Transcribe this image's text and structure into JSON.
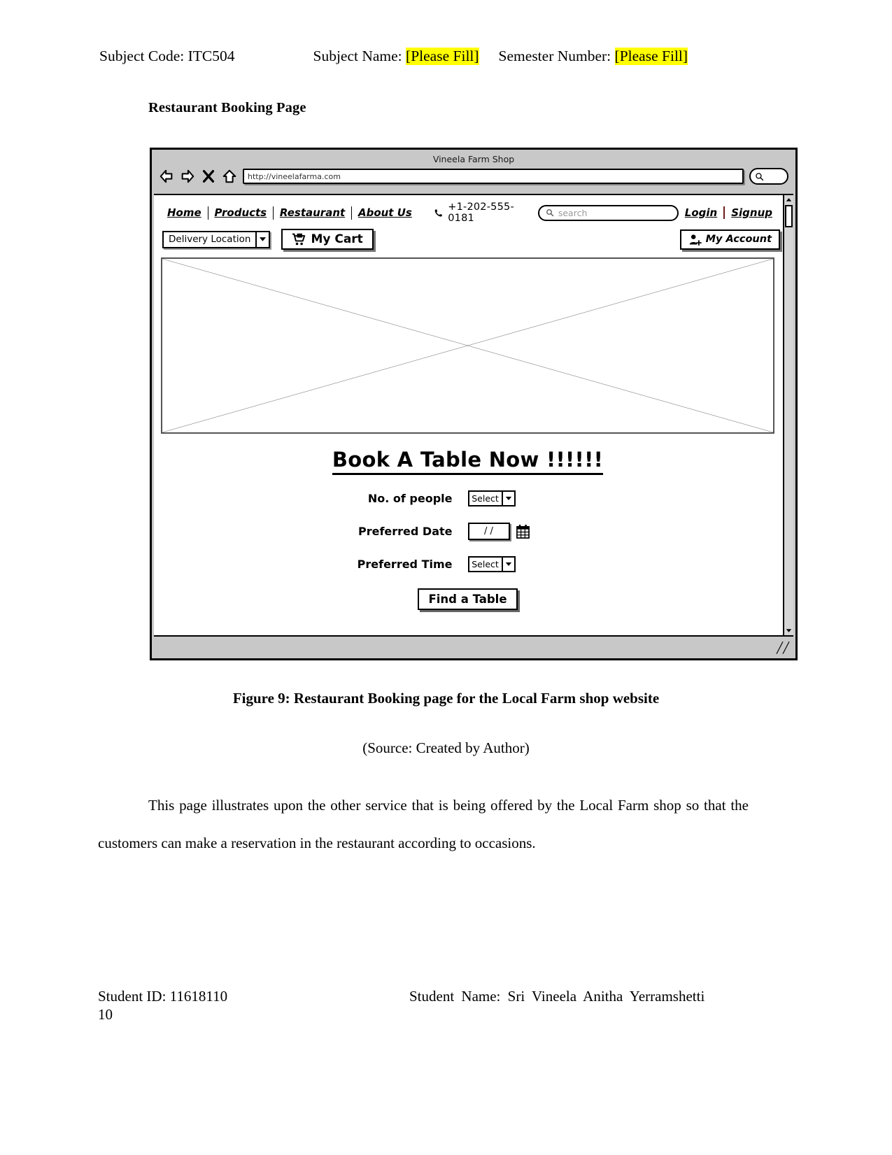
{
  "doc_header": {
    "subject_code_label": "Subject Code: ITC504",
    "subject_name_label": "Subject Name:",
    "subject_name_value": "[Please Fill]",
    "semester_label": "Semester Number:",
    "semester_value": "[Please Fill]"
  },
  "section_title": "Restaurant Booking Page",
  "browser": {
    "window_title": "Vineela Farm Shop",
    "url": "http://vineelafarma.com",
    "back_icon": "back-arrow-icon",
    "forward_icon": "forward-arrow-icon",
    "stop_icon": "close-x-icon",
    "home_icon": "home-icon",
    "search_icon": "search-icon"
  },
  "site": {
    "nav_links": [
      {
        "label": "Home"
      },
      {
        "label": "Products"
      },
      {
        "label": "Restaurant"
      },
      {
        "label": "About Us"
      }
    ],
    "phone": "+1-202-555-0181",
    "phone_icon": "phone-icon",
    "search_placeholder": "search",
    "search_icon": "search-icon",
    "login_label": "Login",
    "signup_label": "Signup",
    "delivery_location_label": "Delivery Location",
    "cart_label": "My Cart",
    "cart_icon": "shopping-cart-icon",
    "account_label": "My Account",
    "account_icon": "user-add-icon"
  },
  "booking": {
    "heading": "Book A Table Now !!!!!!",
    "fields": [
      {
        "label": "No. of people",
        "control": "select",
        "value": "Select"
      },
      {
        "label": "Preferred Date",
        "control": "date",
        "value": "/ /",
        "icon": "calendar-icon"
      },
      {
        "label": "Preferred Time",
        "control": "select",
        "value": "Select"
      }
    ],
    "submit_label": "Find a Table"
  },
  "caption": "Figure 9: Restaurant Booking page for the Local Farm shop website",
  "source": "(Source: Created by Author)",
  "body_paragraph": "This page illustrates upon the other service that is being offered by the Local Farm shop so that the customers can make a reservation in the restaurant according to occasions.",
  "footer": {
    "student_id": "Student ID: 11618110",
    "student_name": "Student Name: Sri Vineela Anitha Yerramshetti",
    "page_number": "10"
  }
}
